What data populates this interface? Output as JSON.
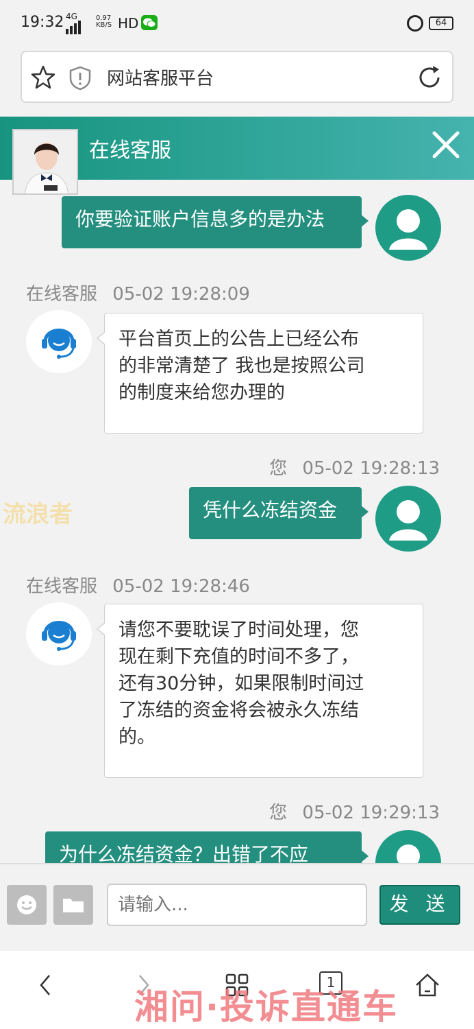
{
  "status_bar": {
    "time": "19:32",
    "network": "4G",
    "speed": "0.97 KB/S",
    "hd": "HD",
    "battery": "64"
  },
  "browser": {
    "page_title": "网站客服平台"
  },
  "chat": {
    "header_title": "在线客服",
    "messages": [
      {
        "from": "user",
        "meta": "",
        "text": "你要验证账户信息多的是办法"
      },
      {
        "from": "agent",
        "meta_name": "在线客服",
        "meta_time": "05-02 19:28:09",
        "lines": [
          "平台首页上的公告上已经公布",
          "的非常清楚了 我也是按照公司",
          "的制度来给您办理的"
        ]
      },
      {
        "from": "user",
        "meta_name": "您",
        "meta_time": "05-02 19:28:13",
        "text": "凭什么冻结资金"
      },
      {
        "from": "agent",
        "meta_name": "在线客服",
        "meta_time": "05-02 19:28:46",
        "lines": [
          "请您不要耽误了时间处理，您",
          "现在剩下充值的时间不多了，",
          "还有30分钟，如果限制时间过",
          "了冻结的资金将会被永久冻结",
          "的。"
        ]
      },
      {
        "from": "user",
        "meta_name": "您",
        "meta_time": "05-02 19:29:13",
        "text": "为什么冻结资金？出错了不应"
      }
    ]
  },
  "watermarks": {
    "left": "流浪者",
    "bottom": "湘问·投诉直通车"
  },
  "composer": {
    "placeholder": "请输入...",
    "send_label": "发 送"
  },
  "nav": {
    "tab_count": "1"
  },
  "colors": {
    "primary": "#258f7f",
    "header_start": "#17947f",
    "header_end": "#45b3ae"
  }
}
